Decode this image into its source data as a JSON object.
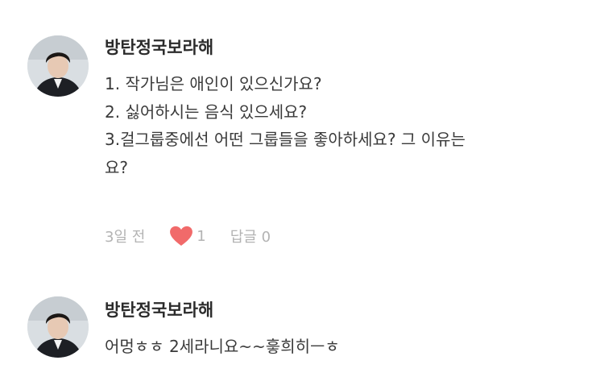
{
  "comments": [
    {
      "author": "방탄정국보라해",
      "lines": [
        "1. 작가님은 애인이 있으신가요?",
        "2. 싫어하시는 음식 있으세요?",
        "3.걸그룹중에선 어떤 그룹들을 좋아하세요? 그 이유는",
        "요?"
      ],
      "time": "3일 전",
      "like_count": "1",
      "reply_label": "답글 0"
    },
    {
      "author": "방탄정국보라해",
      "lines": [
        "어멍ㅎㅎ 2세라니요~~흫희히ㅡㅎ"
      ]
    }
  ],
  "colors": {
    "heart": "#f16a6a",
    "meta_text": "#b3b3b3"
  },
  "icons": {
    "like": "heart-icon"
  }
}
